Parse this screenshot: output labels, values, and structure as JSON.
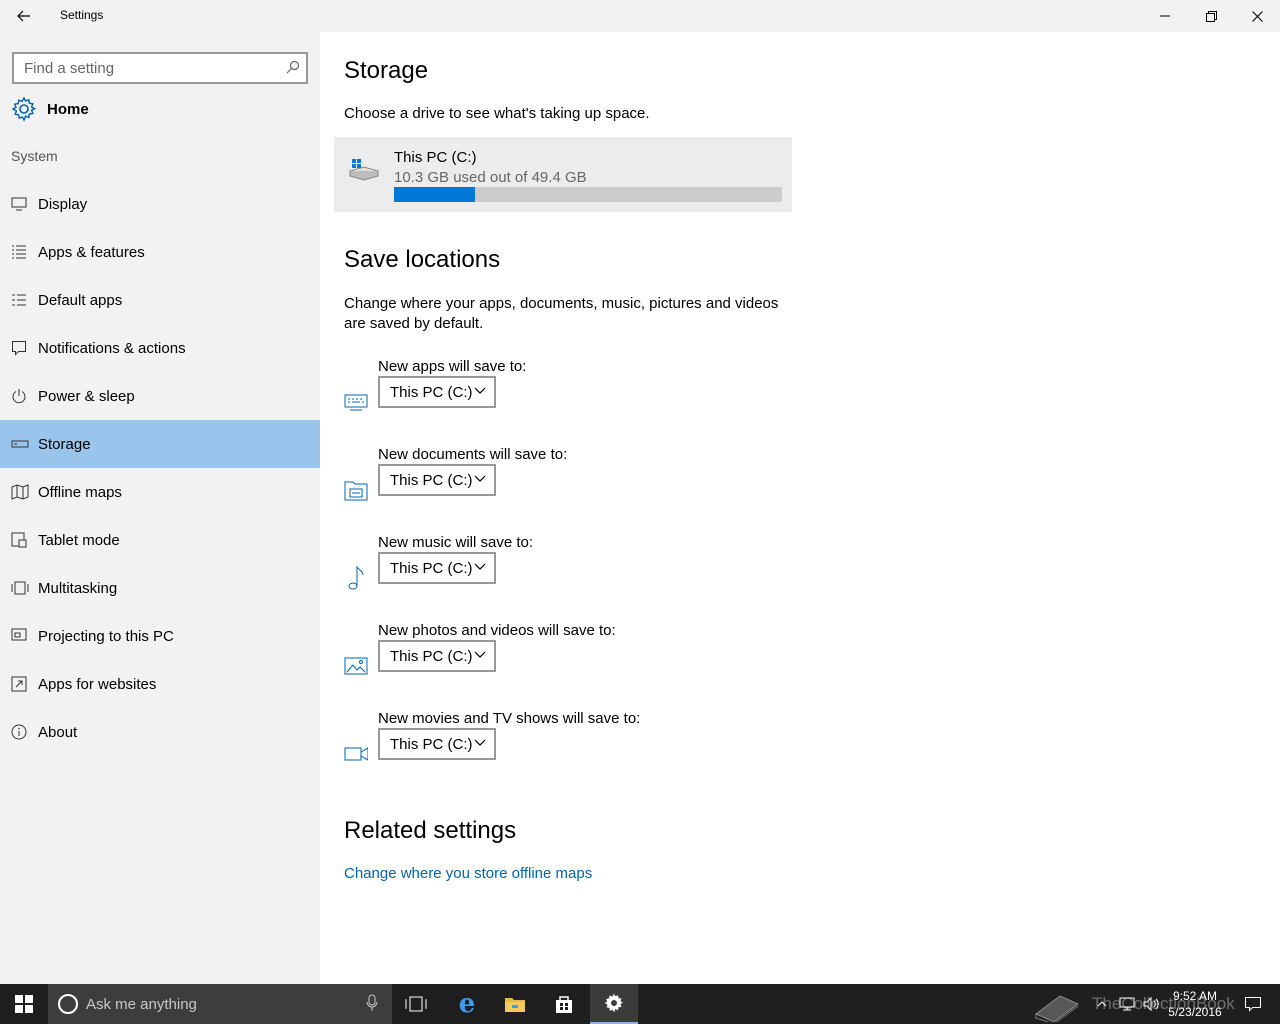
{
  "window": {
    "title": "Settings"
  },
  "sidebar": {
    "search_placeholder": "Find a setting",
    "home_label": "Home",
    "section": "System",
    "items": [
      {
        "label": "Display",
        "icon": "monitor-icon"
      },
      {
        "label": "Apps & features",
        "icon": "list-icon"
      },
      {
        "label": "Default apps",
        "icon": "default-apps-icon"
      },
      {
        "label": "Notifications & actions",
        "icon": "notification-icon"
      },
      {
        "label": "Power & sleep",
        "icon": "power-icon"
      },
      {
        "label": "Storage",
        "icon": "storage-icon",
        "active": true
      },
      {
        "label": "Offline maps",
        "icon": "map-icon"
      },
      {
        "label": "Tablet mode",
        "icon": "tablet-icon"
      },
      {
        "label": "Multitasking",
        "icon": "multitasking-icon"
      },
      {
        "label": "Projecting to this PC",
        "icon": "projecting-icon"
      },
      {
        "label": "Apps for websites",
        "icon": "apps-websites-icon"
      },
      {
        "label": "About",
        "icon": "info-icon"
      }
    ]
  },
  "main": {
    "storage_title": "Storage",
    "storage_desc": "Choose a drive to see what's taking up space.",
    "drive": {
      "name": "This PC (C:)",
      "usage": "10.3 GB used out of 49.4 GB",
      "used_gb": 10.3,
      "total_gb": 49.4
    },
    "save_title": "Save locations",
    "save_desc": "Change where your apps, documents, music, pictures and videos are saved by default.",
    "locations": [
      {
        "label": "New apps will save to:",
        "value": "This PC (C:)",
        "icon": "keyboard-icon"
      },
      {
        "label": "New documents will save to:",
        "value": "This PC (C:)",
        "icon": "documents-icon"
      },
      {
        "label": "New music will save to:",
        "value": "This PC (C:)",
        "icon": "music-icon"
      },
      {
        "label": "New photos and videos will save to:",
        "value": "This PC (C:)",
        "icon": "photo-icon"
      },
      {
        "label": "New movies and TV shows will save to:",
        "value": "This PC (C:)",
        "icon": "video-camera-icon"
      }
    ],
    "related_title": "Related settings",
    "related_link": "Change where you store offline maps"
  },
  "taskbar": {
    "search_placeholder": "Ask me anything",
    "time": "9:52 AM",
    "date": "5/23/2016",
    "watermark": "TheCollectionBook"
  },
  "colors": {
    "accent": "#0078d7",
    "active_nav": "#99c4eb",
    "link": "#0063b1"
  }
}
